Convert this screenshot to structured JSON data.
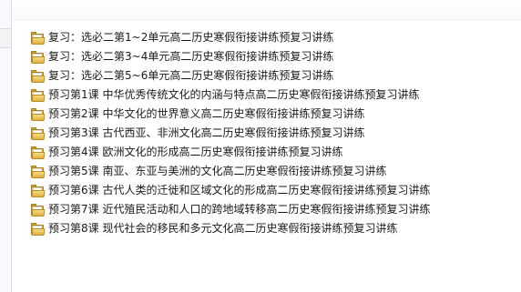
{
  "folders": [
    {
      "icon": "folder-icon",
      "name": "复习：选必二第1~2单元高二历史寒假衔接讲练预复习讲练"
    },
    {
      "icon": "folder-icon",
      "name": "复习：选必二第3~4单元高二历史寒假衔接讲练预复习讲练"
    },
    {
      "icon": "folder-icon",
      "name": "复习：选必二第5~6单元高二历史寒假衔接讲练预复习讲练"
    },
    {
      "icon": "folder-icon",
      "name": "预习第1课 中华优秀传统文化的内涵与特点高二历史寒假衔接讲练预复习讲练"
    },
    {
      "icon": "folder-icon",
      "name": "预习第2课 中华文化的世界意义高二历史寒假衔接讲练预复习讲练"
    },
    {
      "icon": "folder-icon",
      "name": "预习第3课 古代西亚、非洲文化高二历史寒假衔接讲练预复习讲练"
    },
    {
      "icon": "folder-icon",
      "name": "预习第4课 欧洲文化的形成高二历史寒假衔接讲练预复习讲练"
    },
    {
      "icon": "folder-icon",
      "name": "预习第5课 南亚、东亚与美洲的文化高二历史寒假衔接讲练预复习讲练"
    },
    {
      "icon": "folder-icon",
      "name": "预习第6课 古代人类的迁徙和区域文化的形成高二历史寒假衔接讲练预复习讲练"
    },
    {
      "icon": "folder-icon",
      "name": "预习第7课 近代殖民活动和人口的跨地域转移高二历史寒假衔接讲练预复习讲练"
    },
    {
      "icon": "folder-icon",
      "name": "预习第8课 现代社会的移民和多元文化高二历史寒假衔接讲练预复习讲练"
    }
  ]
}
